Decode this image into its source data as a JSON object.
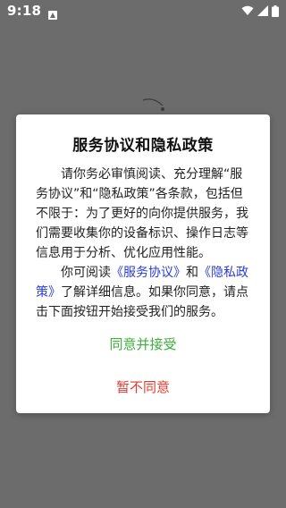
{
  "status_bar": {
    "time": "9:18",
    "notification_icon": "notification-a-icon",
    "wifi_icon": "wifi-icon",
    "signal_icon": "signal-icon",
    "battery_icon": "battery-icon"
  },
  "dialog": {
    "title": "服务协议和隐私政策",
    "paragraph1": "请你务必审慎阅读、充分理解“服务协议”和“隐私政策”各条款，包括但不限于：为了更好的向你提供服务，我们需要收集你的设备标识、操作日志等信息用于分析、优化应用性能。",
    "paragraph2_prefix": "你可阅读",
    "service_link": "《服务协议》",
    "paragraph2_and": "和",
    "privacy_link": "《隐私政策》",
    "paragraph2_suffix": "了解详细信息。如果你同意，请点击下面按钮开始接受我们的服务。",
    "agree_label": "同意并接受",
    "disagree_label": "暂不同意"
  },
  "colors": {
    "overlay": "#6c6c6c",
    "link": "#2a3cd6",
    "agree": "#3fae3f",
    "disagree": "#e23b2e"
  }
}
